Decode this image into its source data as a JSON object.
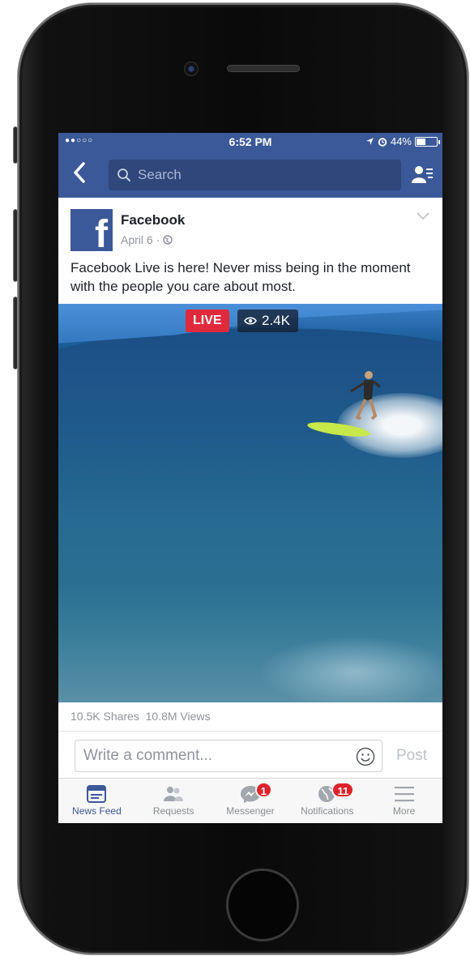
{
  "status_bar": {
    "signal": "●●○○○",
    "time": "6:52 PM",
    "battery_percent": "44%",
    "battery_level": 0.44
  },
  "nav": {
    "search_placeholder": "Search"
  },
  "post": {
    "author": "Facebook",
    "date": "April 6",
    "separator": "·",
    "text": "Facebook Live is here! Never miss being in the moment with the people you care about most.",
    "live_label": "LIVE",
    "viewers": "2.4K",
    "shares": "10.5K Shares",
    "views": "10.8M Views"
  },
  "comment": {
    "placeholder": "Write a comment...",
    "post_label": "Post"
  },
  "tabs": [
    {
      "label": "News Feed",
      "icon": "news-feed-icon",
      "active": true
    },
    {
      "label": "Requests",
      "icon": "friend-requests-icon"
    },
    {
      "label": "Messenger",
      "icon": "messenger-icon",
      "badge": "1"
    },
    {
      "label": "Notifications",
      "icon": "globe-icon",
      "badge": "11"
    },
    {
      "label": "More",
      "icon": "hamburger-menu-icon"
    }
  ],
  "colors": {
    "brand": "#3b5998",
    "live": "#e02a3c",
    "badge": "#e0222a"
  }
}
